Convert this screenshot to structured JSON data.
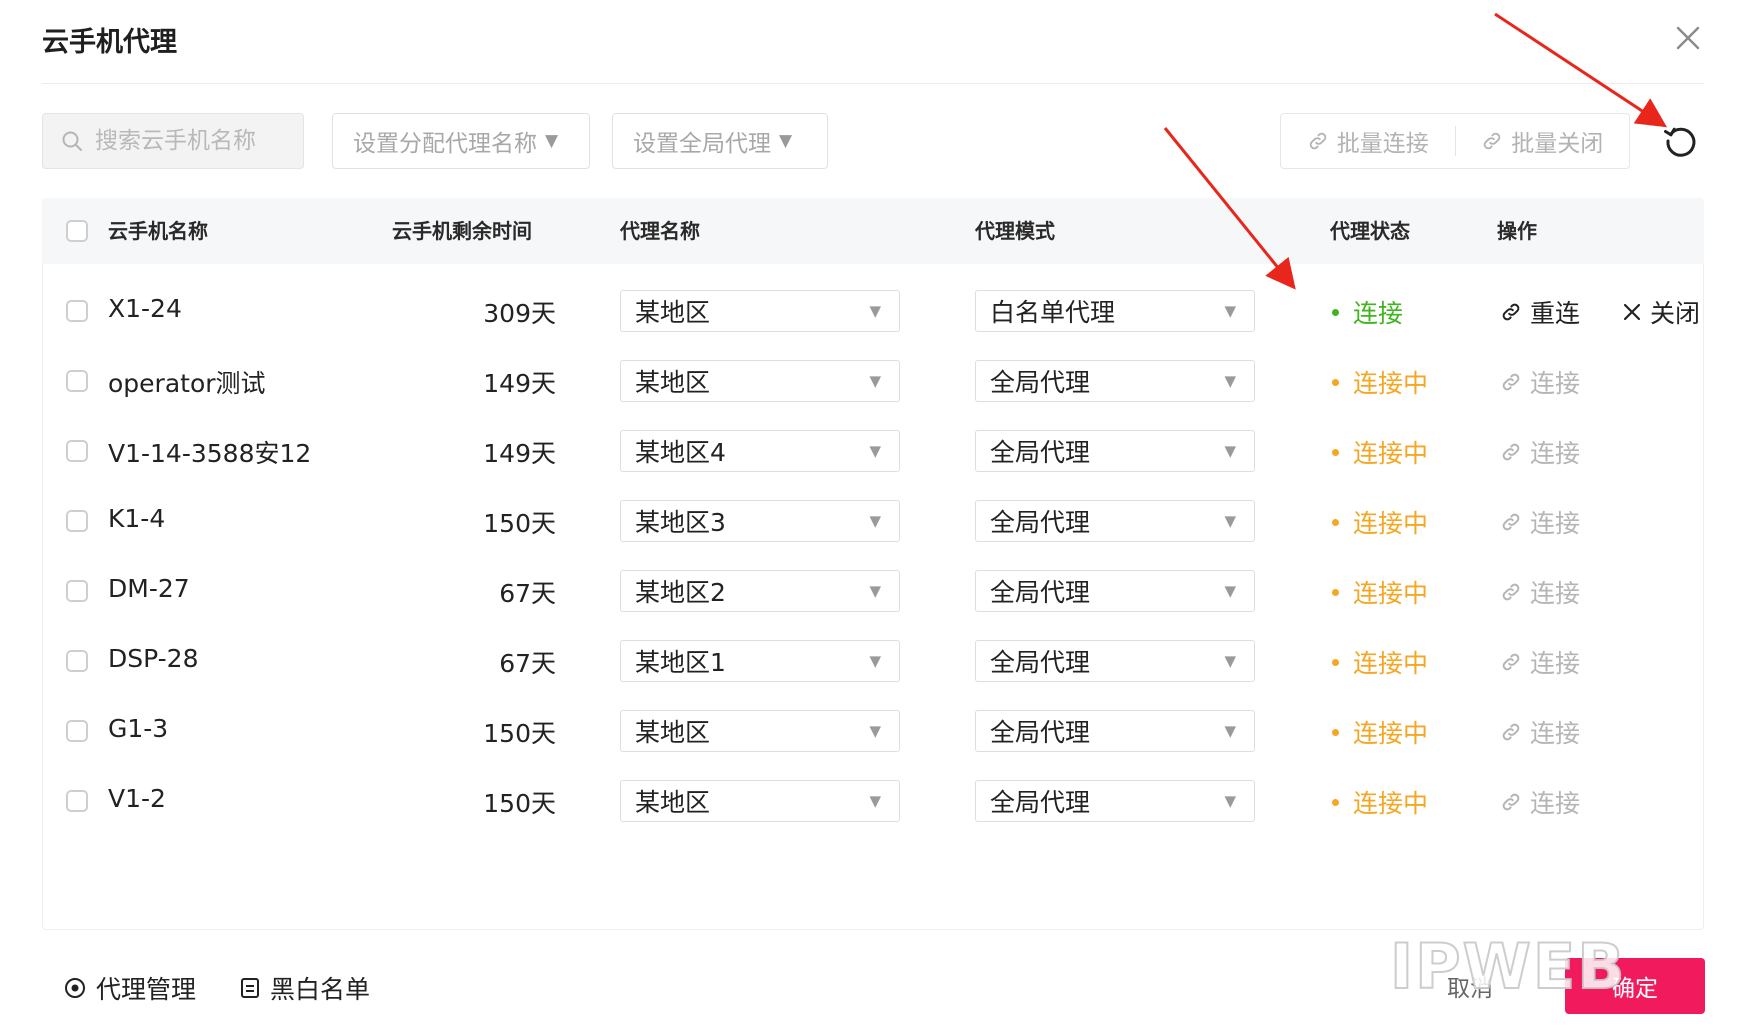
{
  "dialog": {
    "title": "云手机代理"
  },
  "toolbar": {
    "search_placeholder": "搜索云手机名称",
    "assign_proxy_label": "设置分配代理名称",
    "global_proxy_label": "设置全局代理",
    "batch_connect_label": "批量连接",
    "batch_close_label": "批量关闭"
  },
  "table": {
    "headers": {
      "name": "云手机名称",
      "remaining": "云手机剩余时间",
      "proxy_name": "代理名称",
      "proxy_mode": "代理模式",
      "proxy_status": "代理状态",
      "actions": "操作"
    },
    "rows": [
      {
        "name": "X1-24",
        "days": "309天",
        "proxy": "某地区",
        "mode": "白名单代理",
        "status": "连接",
        "op1": "重连",
        "op2": "关闭"
      },
      {
        "name": "operator测试",
        "days": "149天",
        "proxy": "某地区",
        "mode": "全局代理",
        "status": "连接中",
        "op1": "连接"
      },
      {
        "name": "V1-14-3588安12",
        "days": "149天",
        "proxy": "某地区4",
        "mode": "全局代理",
        "status": "连接中",
        "op1": "连接"
      },
      {
        "name": "K1-4",
        "days": "150天",
        "proxy": "某地区3",
        "mode": "全局代理",
        "status": "连接中",
        "op1": "连接"
      },
      {
        "name": "DM-27",
        "days": "67天",
        "proxy": "某地区2",
        "mode": "全局代理",
        "status": "连接中",
        "op1": "连接"
      },
      {
        "name": "DSP-28",
        "days": "67天",
        "proxy": "某地区1",
        "mode": "全局代理",
        "status": "连接中",
        "op1": "连接"
      },
      {
        "name": "G1-3",
        "days": "150天",
        "proxy": "某地区",
        "mode": "全局代理",
        "status": "连接中",
        "op1": "连接"
      },
      {
        "name": "V1-2",
        "days": "150天",
        "proxy": "某地区",
        "mode": "全局代理",
        "status": "连接中",
        "op1": "连接"
      }
    ]
  },
  "footer": {
    "proxy_manage_label": "代理管理",
    "blackwhite_label": "黑白名单",
    "cancel_label": "取消",
    "ok_label": "确定",
    "watermark": "IPWEB"
  },
  "colors": {
    "connected": "#3fb41f",
    "connecting": "#f5a623",
    "muted": "#b5b5b5",
    "primary": "#f01a5c",
    "annotation_arrow": "#e8261b"
  }
}
